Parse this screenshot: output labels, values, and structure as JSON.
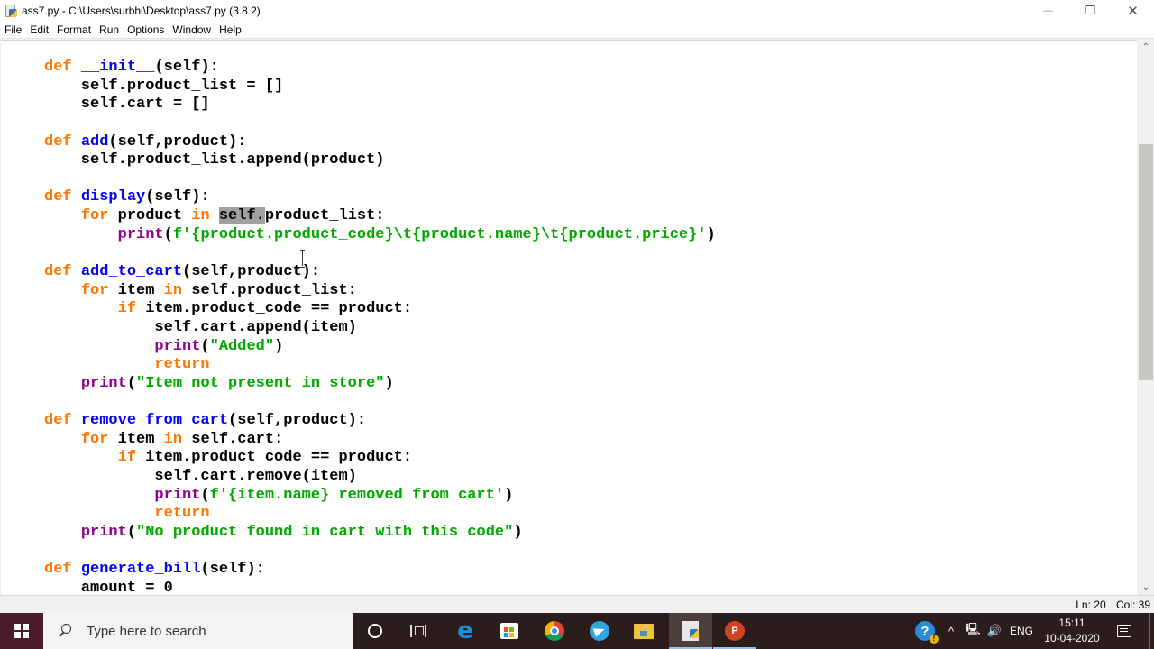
{
  "window": {
    "title": "ass7.py - C:\\Users\\surbhi\\Desktop\\ass7.py (3.8.2)",
    "controls": {
      "minimize": "—",
      "restore": "❐",
      "close": "✕"
    }
  },
  "menu": [
    "File",
    "Edit",
    "Format",
    "Run",
    "Options",
    "Window",
    "Help"
  ],
  "editor": {
    "selected_text": "self.",
    "colors": {
      "keyword": "#ff7700",
      "definition": "#0000ff",
      "builtin": "#900090",
      "string": "#00aa00",
      "selection": "#a0a0a0"
    },
    "lines": [
      [
        [
          "kw",
          "def "
        ],
        [
          "fn",
          "__init__"
        ],
        [
          "",
          "(self):"
        ]
      ],
      [
        [
          "",
          "    self.product_list = []"
        ]
      ],
      [
        [
          "",
          "    self.cart = []"
        ]
      ],
      [],
      [
        [
          "kw",
          "def "
        ],
        [
          "fn",
          "add"
        ],
        [
          "",
          "(self,product):"
        ]
      ],
      [
        [
          "",
          "    self.product_list.append(product)"
        ]
      ],
      [],
      [
        [
          "kw",
          "def "
        ],
        [
          "fn",
          "display"
        ],
        [
          "",
          "(self):"
        ]
      ],
      [
        [
          "",
          "    "
        ],
        [
          "kw",
          "for"
        ],
        [
          "",
          " product "
        ],
        [
          "kw",
          "in"
        ],
        [
          "",
          " "
        ],
        [
          "sel",
          "self."
        ],
        [
          "",
          "product_list:"
        ]
      ],
      [
        [
          "",
          "        "
        ],
        [
          "bi",
          "print"
        ],
        [
          "",
          "("
        ],
        [
          "str",
          "f'{product.product_code}\\t{product.name}\\t{product.price}'"
        ],
        [
          "",
          ")"
        ]
      ],
      [],
      [
        [
          "kw",
          "def "
        ],
        [
          "fn",
          "add_to_cart"
        ],
        [
          "",
          "(self,product):"
        ]
      ],
      [
        [
          "",
          "    "
        ],
        [
          "kw",
          "for"
        ],
        [
          "",
          " item "
        ],
        [
          "kw",
          "in"
        ],
        [
          "",
          " self.product_list:"
        ]
      ],
      [
        [
          "",
          "        "
        ],
        [
          "kw",
          "if"
        ],
        [
          "",
          " item.product_code == product:"
        ]
      ],
      [
        [
          "",
          "            self.cart.append(item)"
        ]
      ],
      [
        [
          "",
          "            "
        ],
        [
          "bi",
          "print"
        ],
        [
          "",
          "("
        ],
        [
          "str",
          "\"Added\""
        ],
        [
          "",
          ")"
        ]
      ],
      [
        [
          "",
          "            "
        ],
        [
          "kw",
          "return"
        ]
      ],
      [
        [
          "",
          "    "
        ],
        [
          "bi",
          "print"
        ],
        [
          "",
          "("
        ],
        [
          "str",
          "\"Item not present in store\""
        ],
        [
          "",
          ")"
        ]
      ],
      [],
      [
        [
          "kw",
          "def "
        ],
        [
          "fn",
          "remove_from_cart"
        ],
        [
          "",
          "(self,product):"
        ]
      ],
      [
        [
          "",
          "    "
        ],
        [
          "kw",
          "for"
        ],
        [
          "",
          " item "
        ],
        [
          "kw",
          "in"
        ],
        [
          "",
          " self.cart:"
        ]
      ],
      [
        [
          "",
          "        "
        ],
        [
          "kw",
          "if"
        ],
        [
          "",
          " item.product_code == product:"
        ]
      ],
      [
        [
          "",
          "            self.cart.remove(item)"
        ]
      ],
      [
        [
          "",
          "            "
        ],
        [
          "bi",
          "print"
        ],
        [
          "",
          "("
        ],
        [
          "str",
          "f'{item.name} removed from cart'"
        ],
        [
          "",
          ")"
        ]
      ],
      [
        [
          "",
          "            "
        ],
        [
          "kw",
          "return"
        ]
      ],
      [
        [
          "",
          "    "
        ],
        [
          "bi",
          "print"
        ],
        [
          "",
          "("
        ],
        [
          "str",
          "\"No product found in cart with this code\""
        ],
        [
          "",
          ")"
        ]
      ],
      [],
      [
        [
          "kw",
          "def "
        ],
        [
          "fn",
          "generate_bill"
        ],
        [
          "",
          "(self):"
        ]
      ],
      [
        [
          "",
          "    amount = 0"
        ]
      ]
    ]
  },
  "scrollbar": {
    "position_fraction": 0.17,
    "visible_fraction": 0.45,
    "up_arrow": "⌃",
    "down_arrow": "⌄"
  },
  "status": {
    "line": "Ln: 20",
    "col": "Col: 39"
  },
  "taskbar": {
    "search_placeholder": "Type here to search",
    "apps": [
      "cortana",
      "task-view",
      "edge",
      "microsoft-store",
      "chrome",
      "telegram",
      "file-explorer",
      "python-idle",
      "powerpoint"
    ],
    "powerpoint_label": "P",
    "tray": {
      "help_label": "?",
      "chevron": "^",
      "language": "ENG",
      "time": "15:11",
      "date": "10-04-2020"
    }
  }
}
